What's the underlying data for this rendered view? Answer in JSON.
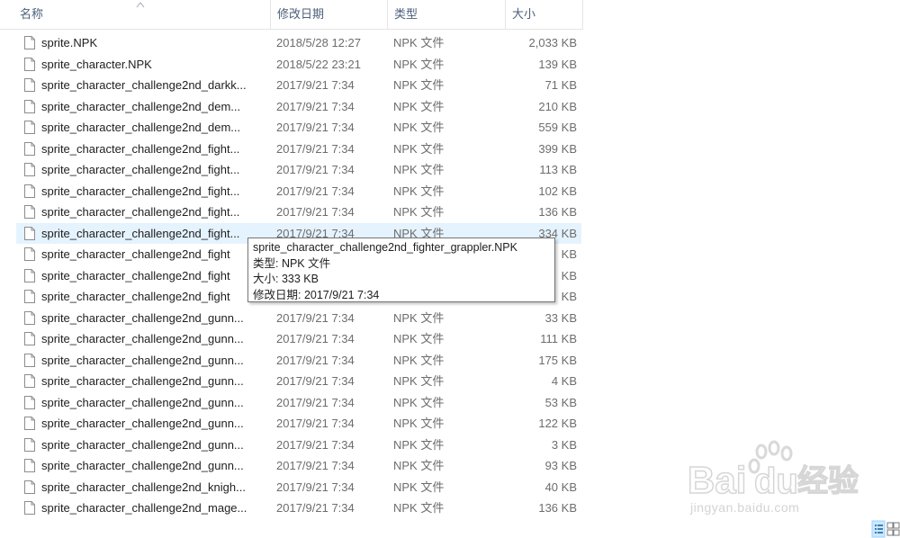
{
  "header": {
    "name": "名称",
    "date": "修改日期",
    "type": "类型",
    "size": "大小"
  },
  "rows": [
    {
      "name": "sprite.NPK",
      "date": "2018/5/28 12:27",
      "type": "NPK 文件",
      "size": "2,033 KB"
    },
    {
      "name": "sprite_character.NPK",
      "date": "2018/5/22 23:21",
      "type": "NPK 文件",
      "size": "139 KB"
    },
    {
      "name": "sprite_character_challenge2nd_darkk...",
      "date": "2017/9/21 7:34",
      "type": "NPK 文件",
      "size": "71 KB"
    },
    {
      "name": "sprite_character_challenge2nd_dem...",
      "date": "2017/9/21 7:34",
      "type": "NPK 文件",
      "size": "210 KB"
    },
    {
      "name": "sprite_character_challenge2nd_dem...",
      "date": "2017/9/21 7:34",
      "type": "NPK 文件",
      "size": "559 KB"
    },
    {
      "name": "sprite_character_challenge2nd_fight...",
      "date": "2017/9/21 7:34",
      "type": "NPK 文件",
      "size": "399 KB"
    },
    {
      "name": "sprite_character_challenge2nd_fight...",
      "date": "2017/9/21 7:34",
      "type": "NPK 文件",
      "size": "113 KB"
    },
    {
      "name": "sprite_character_challenge2nd_fight...",
      "date": "2017/9/21 7:34",
      "type": "NPK 文件",
      "size": "102 KB"
    },
    {
      "name": "sprite_character_challenge2nd_fight...",
      "date": "2017/9/21 7:34",
      "type": "NPK 文件",
      "size": "136 KB"
    },
    {
      "name": "sprite_character_challenge2nd_fight...",
      "date": "2017/9/21 7:34",
      "type": "NPK 文件",
      "size": "334 KB"
    },
    {
      "name": "sprite_character_challenge2nd_fight",
      "date": "",
      "type": "",
      "size": "KB"
    },
    {
      "name": "sprite_character_challenge2nd_fight",
      "date": "",
      "type": "",
      "size": "KB"
    },
    {
      "name": "sprite_character_challenge2nd_fight",
      "date": "",
      "type": "",
      "size": "KB"
    },
    {
      "name": "sprite_character_challenge2nd_gunn...",
      "date": "2017/9/21 7:34",
      "type": "NPK 文件",
      "size": "33 KB"
    },
    {
      "name": "sprite_character_challenge2nd_gunn...",
      "date": "2017/9/21 7:34",
      "type": "NPK 文件",
      "size": "111 KB"
    },
    {
      "name": "sprite_character_challenge2nd_gunn...",
      "date": "2017/9/21 7:34",
      "type": "NPK 文件",
      "size": "175 KB"
    },
    {
      "name": "sprite_character_challenge2nd_gunn...",
      "date": "2017/9/21 7:34",
      "type": "NPK 文件",
      "size": "4 KB"
    },
    {
      "name": "sprite_character_challenge2nd_gunn...",
      "date": "2017/9/21 7:34",
      "type": "NPK 文件",
      "size": "53 KB"
    },
    {
      "name": "sprite_character_challenge2nd_gunn...",
      "date": "2017/9/21 7:34",
      "type": "NPK 文件",
      "size": "122 KB"
    },
    {
      "name": "sprite_character_challenge2nd_gunn...",
      "date": "2017/9/21 7:34",
      "type": "NPK 文件",
      "size": "3 KB"
    },
    {
      "name": "sprite_character_challenge2nd_gunn...",
      "date": "2017/9/21 7:34",
      "type": "NPK 文件",
      "size": "93 KB"
    },
    {
      "name": "sprite_character_challenge2nd_knigh...",
      "date": "2017/9/21 7:34",
      "type": "NPK 文件",
      "size": "40 KB"
    },
    {
      "name": "sprite_character_challenge2nd_mage...",
      "date": "2017/9/21 7:34",
      "type": "NPK 文件",
      "size": "136 KB"
    }
  ],
  "tooltip": {
    "filename": "sprite_character_challenge2nd_fighter_grappler.NPK",
    "type_line": "类型: NPK 文件",
    "size_line": "大小: 333 KB",
    "date_line": "修改日期: 2017/9/21 7:34"
  },
  "watermark": {
    "logo_text": "Bai du 经验",
    "url": "jingyan.baidu.com"
  },
  "icons": {
    "file": "file-icon",
    "sort": "sort-up-arrow-icon",
    "details_view": "details-view-icon",
    "tiles_view": "large-icons-view-icon"
  }
}
